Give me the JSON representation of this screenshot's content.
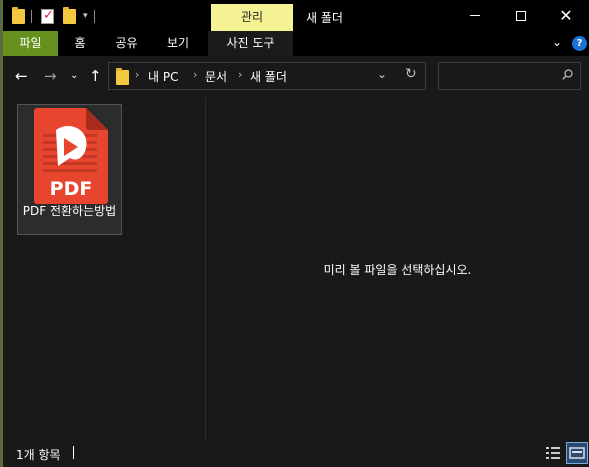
{
  "window": {
    "title": "새 폴더",
    "context_tab": "관리"
  },
  "ribbon": {
    "tabs": [
      {
        "label": "파일"
      },
      {
        "label": "홈"
      },
      {
        "label": "공유"
      },
      {
        "label": "보기"
      },
      {
        "label": "사진 도구"
      }
    ]
  },
  "address": {
    "breadcrumbs": [
      "내 PC",
      "문서",
      "새 폴더"
    ]
  },
  "search": {
    "placeholder": ""
  },
  "files": [
    {
      "name": "PDF 전환하는방법",
      "icon_label": "PDF"
    }
  ],
  "preview": {
    "message": "미리 볼 파일을 선택하십시오."
  },
  "status": {
    "count": "1개 항목"
  },
  "colors": {
    "manage_tab": "#f5f294",
    "file_tab": "#66911e",
    "pdf_red": "#e8452f",
    "background": "#191919"
  }
}
